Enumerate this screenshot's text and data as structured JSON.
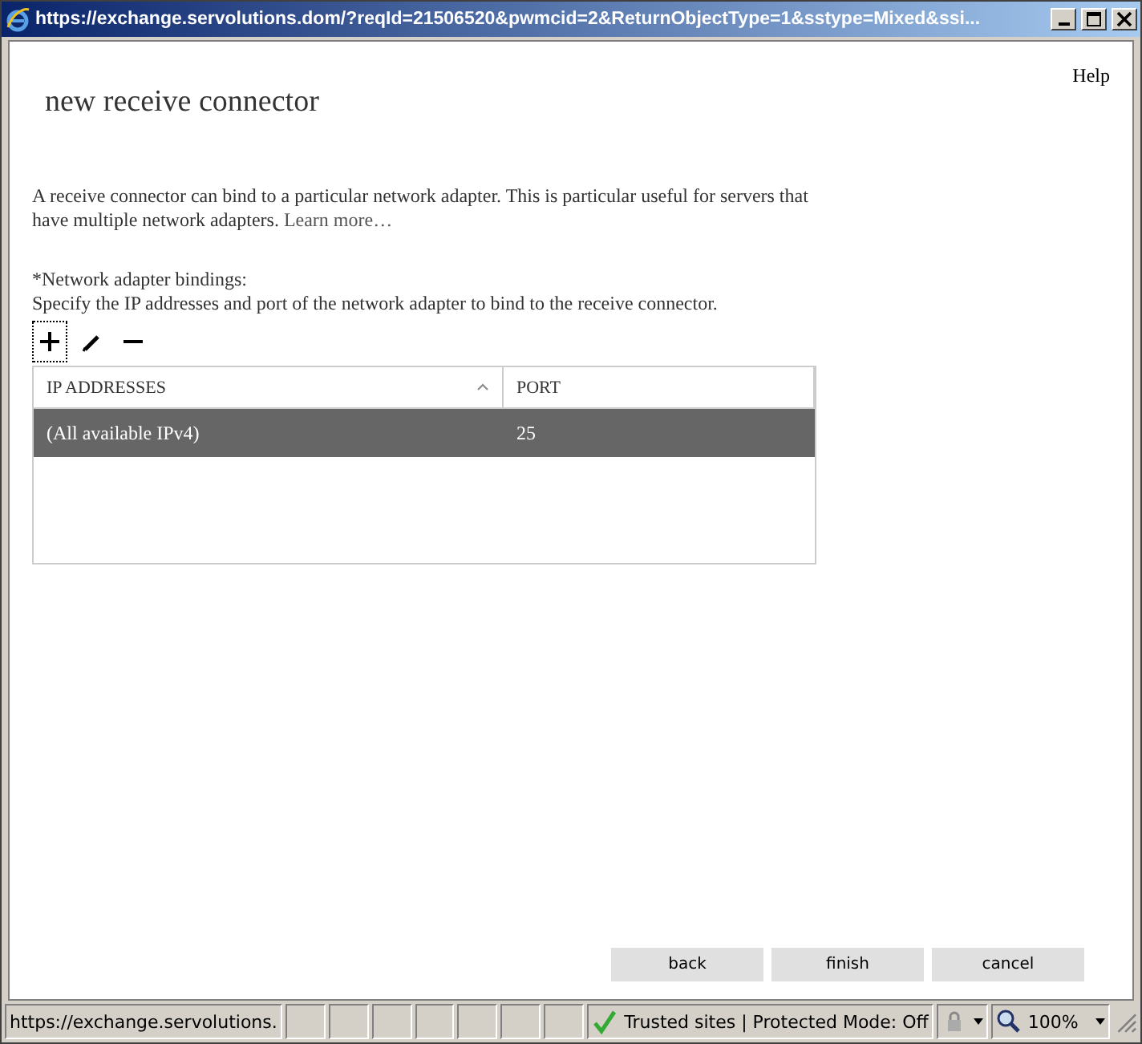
{
  "window": {
    "title": "https://exchange.servolutions.dom/?reqId=21506520&pwmcid=2&ReturnObjectType=1&sstype=Mixed&ssi..."
  },
  "help": "Help",
  "heading": "new receive connector",
  "description": {
    "text": "A receive connector can bind to a particular network adapter. This is particular useful for servers that have multiple network adapters.",
    "link": "Learn more…"
  },
  "bindings": {
    "label": "*Network adapter bindings:",
    "instruction": "Specify the IP addresses and port of the network adapter to bind to the receive connector."
  },
  "toolbar": [
    {
      "kind": "add",
      "focused": true
    },
    {
      "kind": "edit",
      "focused": false
    },
    {
      "kind": "remove",
      "focused": false
    }
  ],
  "table": {
    "columns": [
      {
        "label": "IP ADDRESSES",
        "sorted": true
      },
      {
        "label": "PORT",
        "sorted": false
      }
    ],
    "rows": [
      {
        "cells": [
          "(All available IPv4)",
          "25"
        ],
        "selected": true
      }
    ]
  },
  "buttons": [
    "back",
    "finish",
    "cancel"
  ],
  "status_bar": {
    "url": "https://exchange.servolutions.",
    "zone": "Trusted sites | Protected Mode: Off",
    "zoom": "100%"
  }
}
